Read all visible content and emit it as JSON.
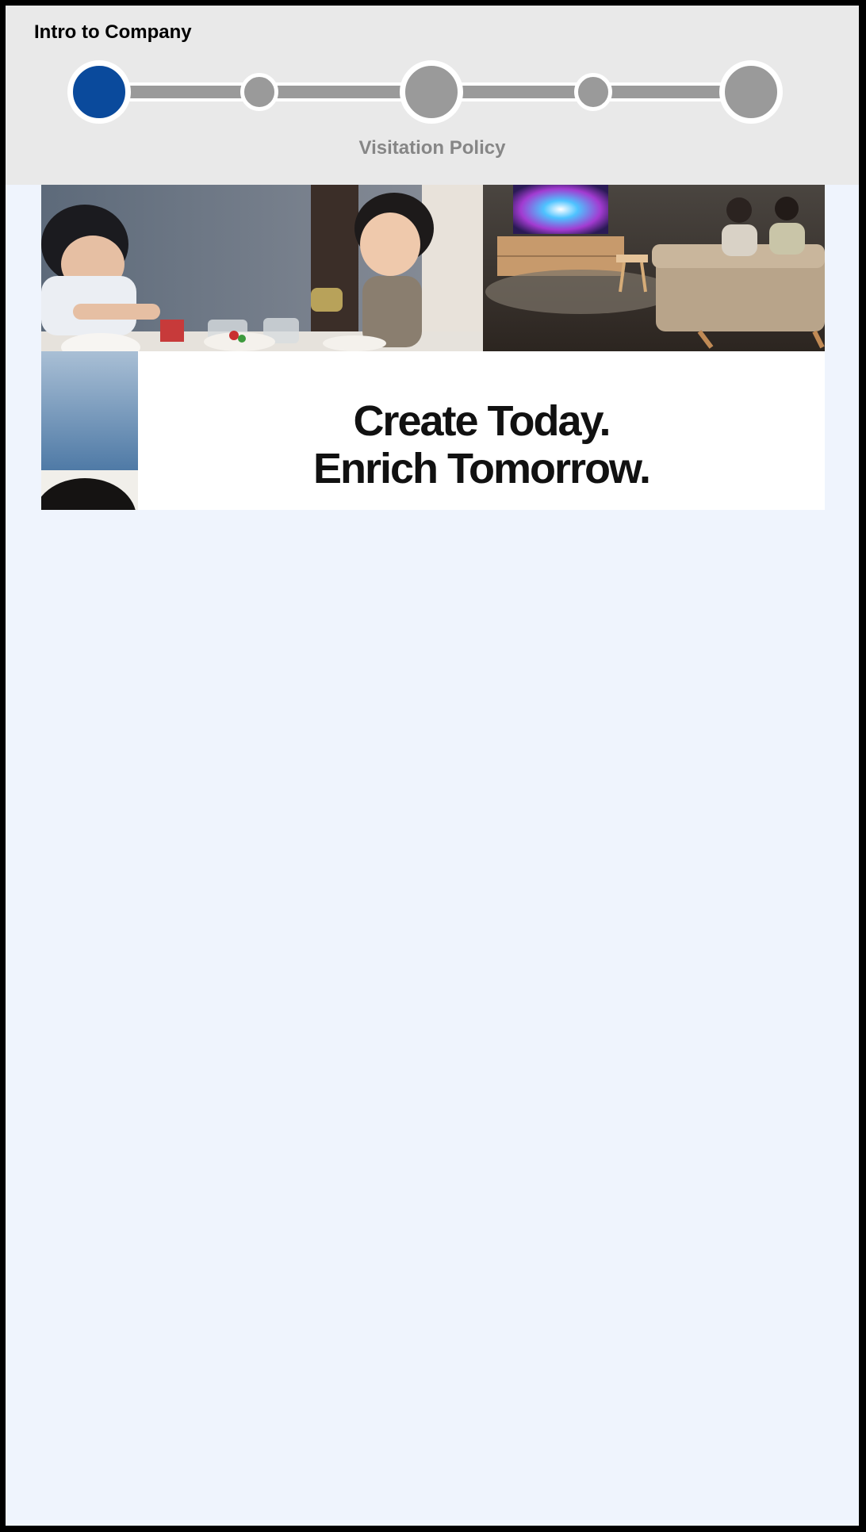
{
  "header": {
    "title": "Intro to Company"
  },
  "stepper": {
    "current_step_label": "Visitation Policy",
    "active_color": "#0a4a9c",
    "inactive_color": "#9a9a9a",
    "steps": [
      {
        "kind": "major",
        "state": "active"
      },
      {
        "kind": "minor",
        "state": "inactive"
      },
      {
        "kind": "major",
        "state": "inactive"
      },
      {
        "kind": "minor",
        "state": "inactive"
      },
      {
        "kind": "major",
        "state": "inactive"
      }
    ]
  },
  "banner": {
    "headline_line1": "Create Today.",
    "headline_line2": "Enrich Tomorrow."
  }
}
